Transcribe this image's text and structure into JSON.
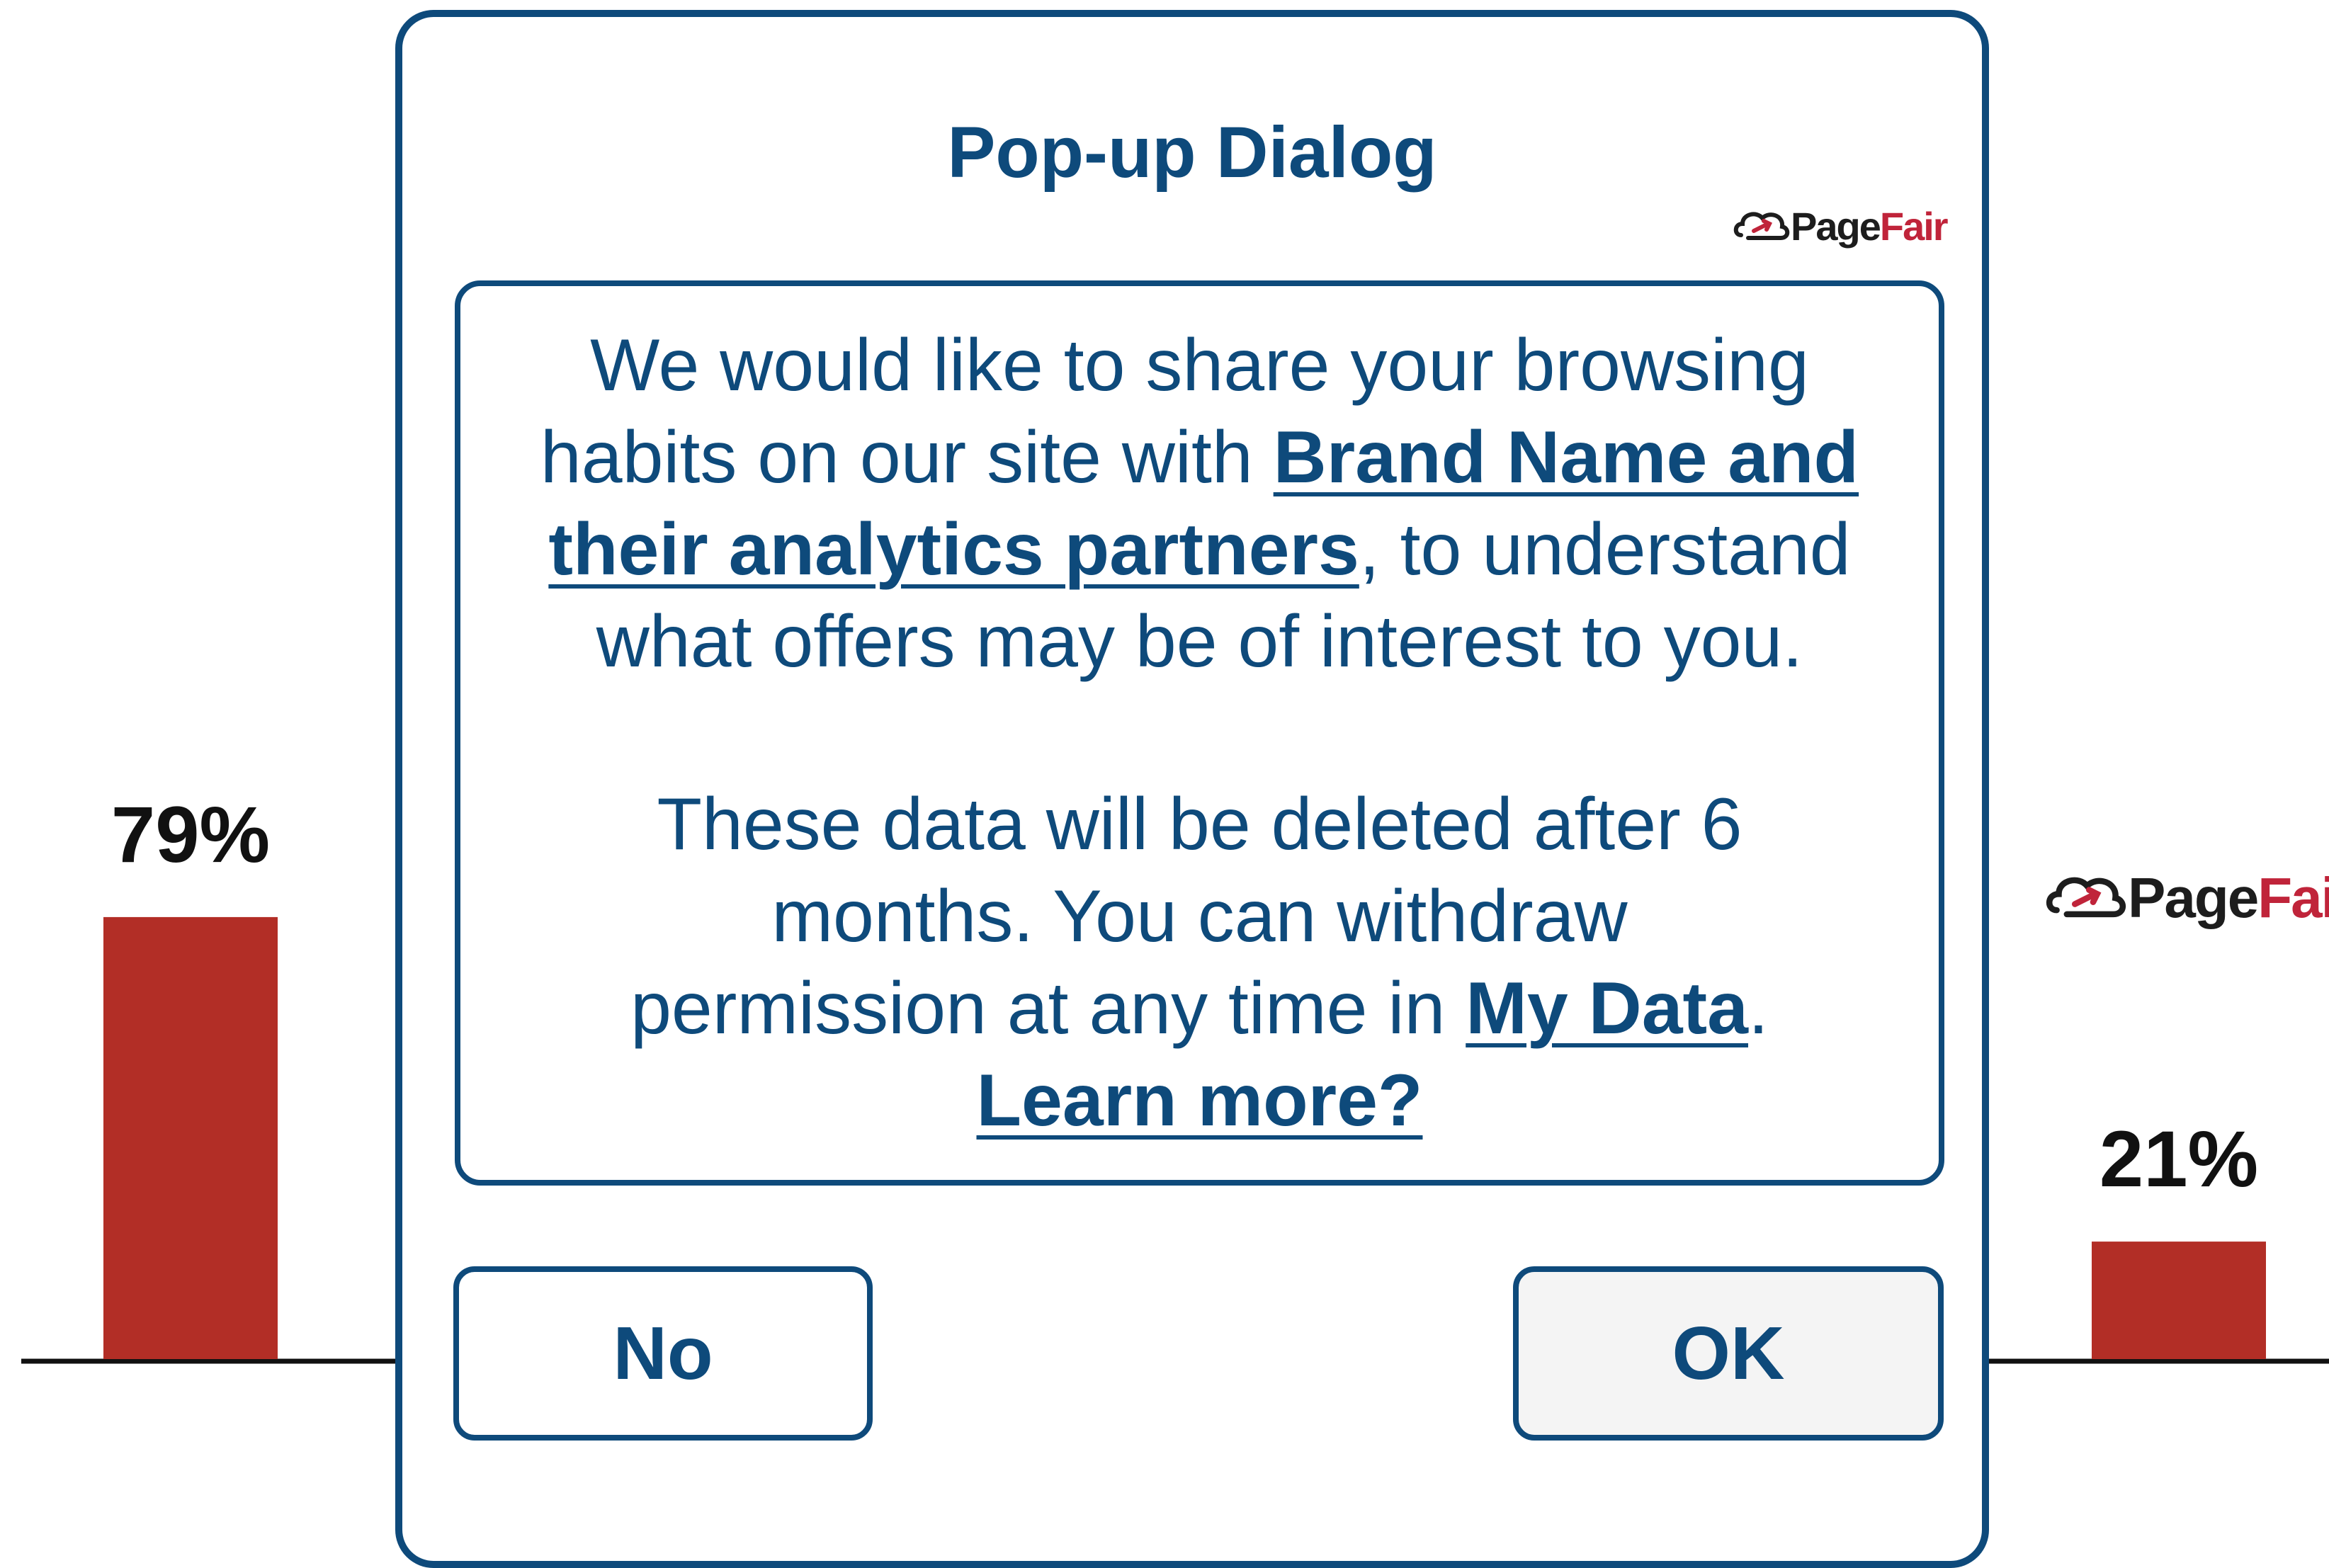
{
  "chart_data": {
    "type": "bar",
    "categories": [
      "",
      ""
    ],
    "values": [
      79,
      21
    ],
    "data_labels": [
      "79%",
      "21%"
    ],
    "ylim": [
      0,
      100
    ],
    "bar_color": "#b22e26",
    "grid": false
  },
  "dialog": {
    "title": "Pop-up Dialog",
    "logo": {
      "part1": "Page",
      "part2": "Fair"
    },
    "message": {
      "p1_before": "We would like to share your browsing habits on our site with ",
      "p1_link": "Brand Name and their analytics partners",
      "p1_after": ", to understand what offers may be of interest to you.",
      "p2_before": "These data will be deleted after 6 months. You can withdraw permission at any time in ",
      "p2_link": "My Data",
      "p2_after": ".",
      "learn_more": "Learn more?"
    },
    "no_label": "No",
    "ok_label": "OK"
  },
  "watermark": {
    "part1": "Page",
    "part2": "Fair"
  },
  "colors": {
    "dialog_accent": "#0e4a7b",
    "bar": "#b22e26",
    "logo_red": "#c0243a"
  }
}
